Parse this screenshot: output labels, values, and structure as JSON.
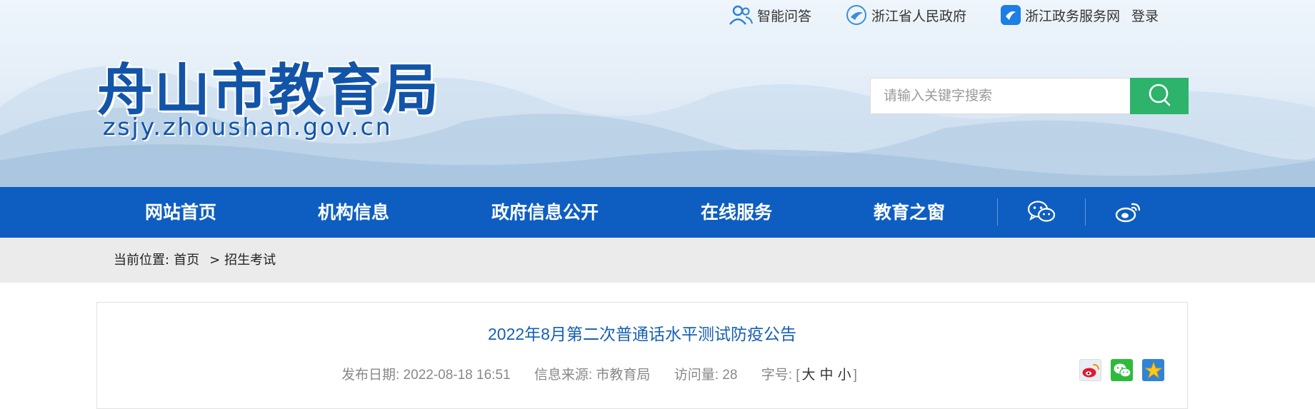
{
  "header": {
    "toplinks": [
      {
        "label": "智能问答",
        "icon": "users-icon"
      },
      {
        "label": "浙江省人民政府",
        "icon": "zj-gov-logo-icon"
      },
      {
        "label": "浙江政务服务网",
        "icon": "zj-service-logo-icon"
      }
    ],
    "login_label": "登录",
    "logo_cn": "舟山市教育局",
    "logo_en": "zsjy.zhoushan.gov.cn",
    "search_placeholder": "请输入关键字搜索",
    "colors": {
      "brand_blue": "#0e5ec2",
      "search_green": "#2db36b"
    }
  },
  "nav": {
    "items": [
      "网站首页",
      "机构信息",
      "政府信息公开",
      "在线服务",
      "教育之窗"
    ],
    "icons": [
      "wechat-icon",
      "weibo-icon"
    ]
  },
  "breadcrumb": {
    "prefix": "当前位置:",
    "home": "首页",
    "separator": ">",
    "current": "招生考试"
  },
  "article": {
    "title": "2022年8月第二次普通话水平测试防疫公告",
    "publish_date": "发布日期: 2022-08-18 16:51",
    "source": "信息来源: 市教育局",
    "visits": "访问量: 28",
    "font_size_label": "字号: [",
    "font_large": "大",
    "font_medium": "中",
    "font_small": "小",
    "font_close": "]",
    "share_icons": [
      "weibo-share-icon",
      "wechat-share-icon",
      "qzone-share-icon"
    ]
  }
}
